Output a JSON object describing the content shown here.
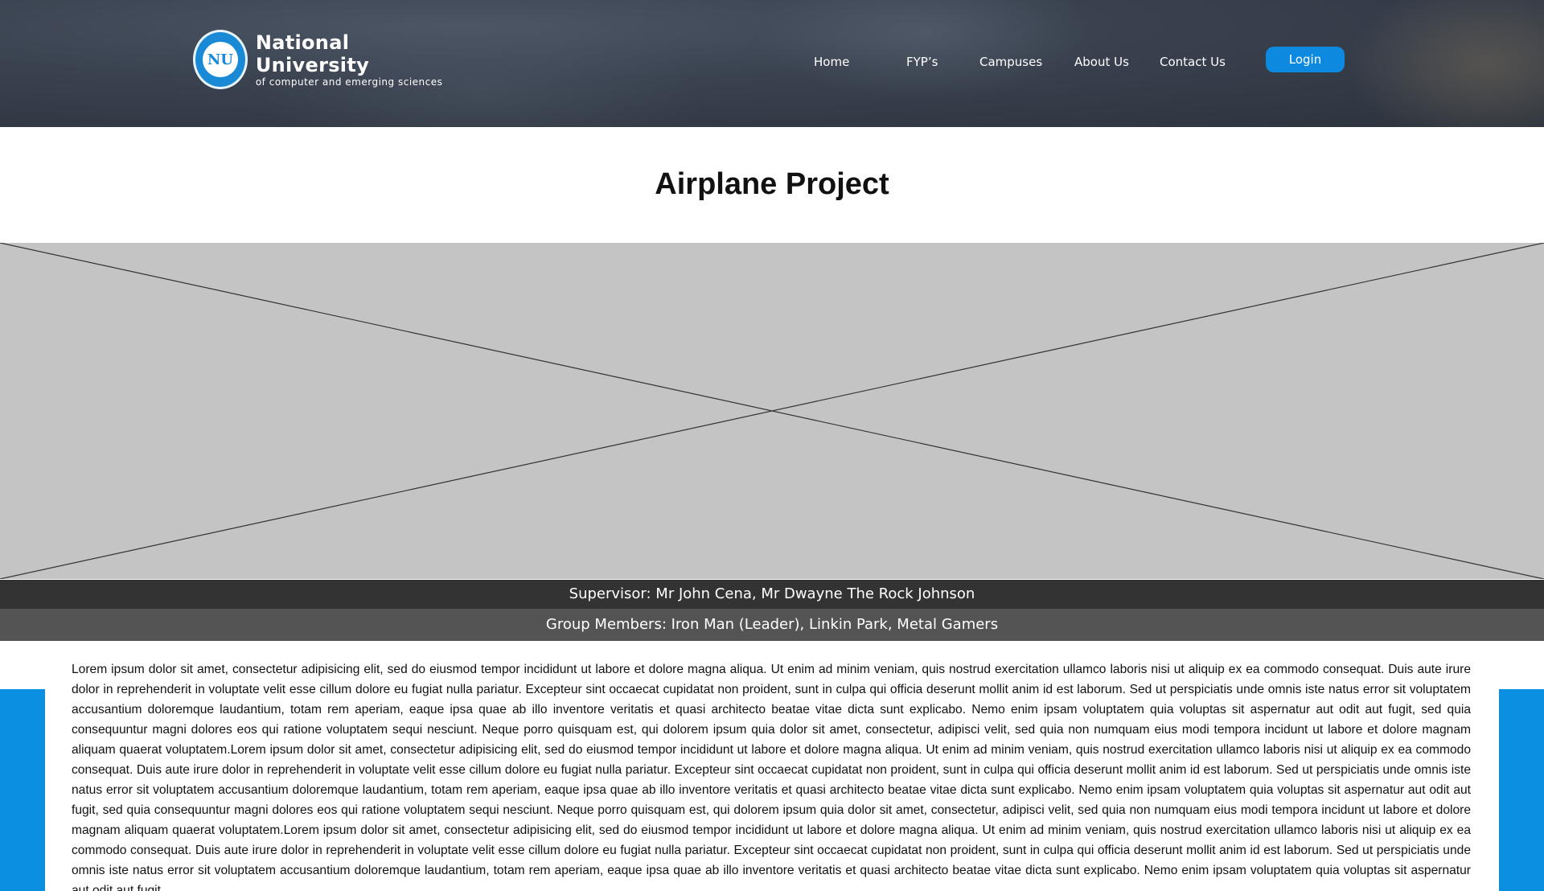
{
  "header": {
    "logo": {
      "name": "National University",
      "subtitle": "of computer and emerging sciences",
      "seal_text": "NU"
    },
    "nav": [
      {
        "label": "Home"
      },
      {
        "label": "FYP’s"
      },
      {
        "label": "Campuses"
      },
      {
        "label": "About Us"
      },
      {
        "label": "Contact Us"
      }
    ],
    "login_label": "Login"
  },
  "project": {
    "title": "Airplane Project",
    "supervisor": "Supervisor: Mr John Cena, Mr Dwayne The Rock Johnson",
    "members": "Group Members: Iron Man (Leader), Linkin Park, Metal Gamers",
    "description": "Lorem ipsum dolor sit amet, consectetur adipisicing elit, sed do eiusmod tempor incididunt ut labore et dolore magna aliqua. Ut enim ad minim veniam, quis nostrud exercitation ullamco laboris nisi ut aliquip ex ea commodo consequat. Duis aute irure dolor in reprehenderit in voluptate velit esse cillum dolore eu fugiat nulla pariatur. Excepteur sint occaecat cupidatat non proident, sunt in culpa qui officia deserunt mollit anim id est laborum. Sed ut perspiciatis unde omnis iste natus error sit voluptatem accusantium doloremque laudantium, totam rem aperiam, eaque ipsa quae ab illo inventore veritatis et quasi architecto beatae vitae dicta sunt explicabo. Nemo enim ipsam voluptatem quia voluptas sit aspernatur aut odit aut fugit, sed quia consequuntur magni dolores eos qui ratione voluptatem sequi nesciunt. Neque porro quisquam est, qui dolorem ipsum quia dolor sit amet, consectetur, adipisci velit, sed quia non numquam eius modi tempora incidunt ut labore et dolore magnam aliquam quaerat voluptatem.Lorem ipsum dolor sit amet, consectetur adipisicing elit, sed do eiusmod tempor incididunt ut labore et dolore magna aliqua. Ut enim ad minim veniam, quis nostrud exercitation ullamco laboris nisi ut aliquip ex ea commodo consequat. Duis aute irure dolor in reprehenderit in voluptate velit esse cillum dolore eu fugiat nulla pariatur. Excepteur sint occaecat cupidatat non proident, sunt in culpa qui officia deserunt mollit anim id est laborum. Sed ut perspiciatis unde omnis iste natus error sit voluptatem accusantium doloremque laudantium, totam rem aperiam, eaque ipsa quae ab illo inventore veritatis et quasi architecto beatae vitae dicta sunt explicabo. Nemo enim ipsam voluptatem quia voluptas sit aspernatur aut odit aut fugit, sed quia consequuntur magni dolores eos qui ratione voluptatem sequi nesciunt. Neque porro quisquam est, qui dolorem ipsum quia dolor sit amet, consectetur, adipisci velit, sed quia non numquam eius modi tempora incidunt ut labore et dolore magnam aliquam quaerat voluptatem.Lorem ipsum dolor sit amet, consectetur adipisicing elit, sed do eiusmod tempor incididunt ut labore et dolore magna aliqua. Ut enim ad minim veniam, quis nostrud exercitation ullamco laboris nisi ut aliquip ex ea commodo consequat. Duis aute irure dolor in reprehenderit in voluptate velit esse cillum dolore eu fugiat nulla pariatur. Excepteur sint occaecat cupidatat non proident, sunt in culpa qui officia deserunt mollit anim id est laborum. Sed ut perspiciatis unde omnis iste natus error sit voluptatem accusantium doloremque laudantium, totam rem aperiam, eaque ipsa quae ab illo inventore veritatis et quasi architecto beatae vitae dicta sunt explicabo. Nemo enim ipsam voluptatem quia voluptas sit aspernatur aut odit aut fugit."
  },
  "colors": {
    "accent": "#0b8fe0",
    "supervisor_bar": "#333333",
    "members_bar": "#545454",
    "placeholder": "#c4c4c4"
  }
}
